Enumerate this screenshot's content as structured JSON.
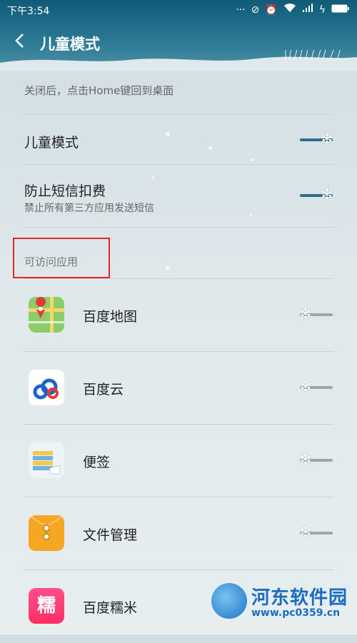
{
  "status_bar": {
    "time": "下午3:54",
    "icons": [
      "more-icon",
      "alarm-off-icon",
      "alarm-clock-icon",
      "wifi-icon",
      "signal-icon",
      "charging-icon",
      "battery-icon"
    ]
  },
  "header": {
    "title": "儿童模式",
    "back_icon": "back-chevron-icon"
  },
  "hint": "关闭后，点击Home键回到桌面",
  "settings": {
    "kids_mode": {
      "label": "儿童模式",
      "enabled": true
    },
    "block_sms": {
      "label": "防止短信扣费",
      "sublabel": "禁止所有第三方应用发送短信",
      "enabled": true
    }
  },
  "section": {
    "label": "可访问应用"
  },
  "apps": [
    {
      "name": "百度地图",
      "icon": "baidu-map-icon",
      "enabled": false
    },
    {
      "name": "百度云",
      "icon": "baidu-cloud-icon",
      "enabled": false
    },
    {
      "name": "便签",
      "icon": "notes-icon",
      "enabled": false
    },
    {
      "name": "文件管理",
      "icon": "file-manager-icon",
      "enabled": false
    },
    {
      "name": "百度糯米",
      "icon": "baidu-nuomi-icon",
      "icon_text": "糯",
      "enabled": false
    }
  ],
  "watermark": {
    "text": "河东软件园",
    "url": "www.pc0359.cn"
  },
  "colors": {
    "header": "#0f5b78",
    "toggle_on": "#2d6f8a",
    "toggle_off": "#9ea6a8",
    "highlight_box": "#e0262a",
    "watermark": "#1a6bc2"
  }
}
